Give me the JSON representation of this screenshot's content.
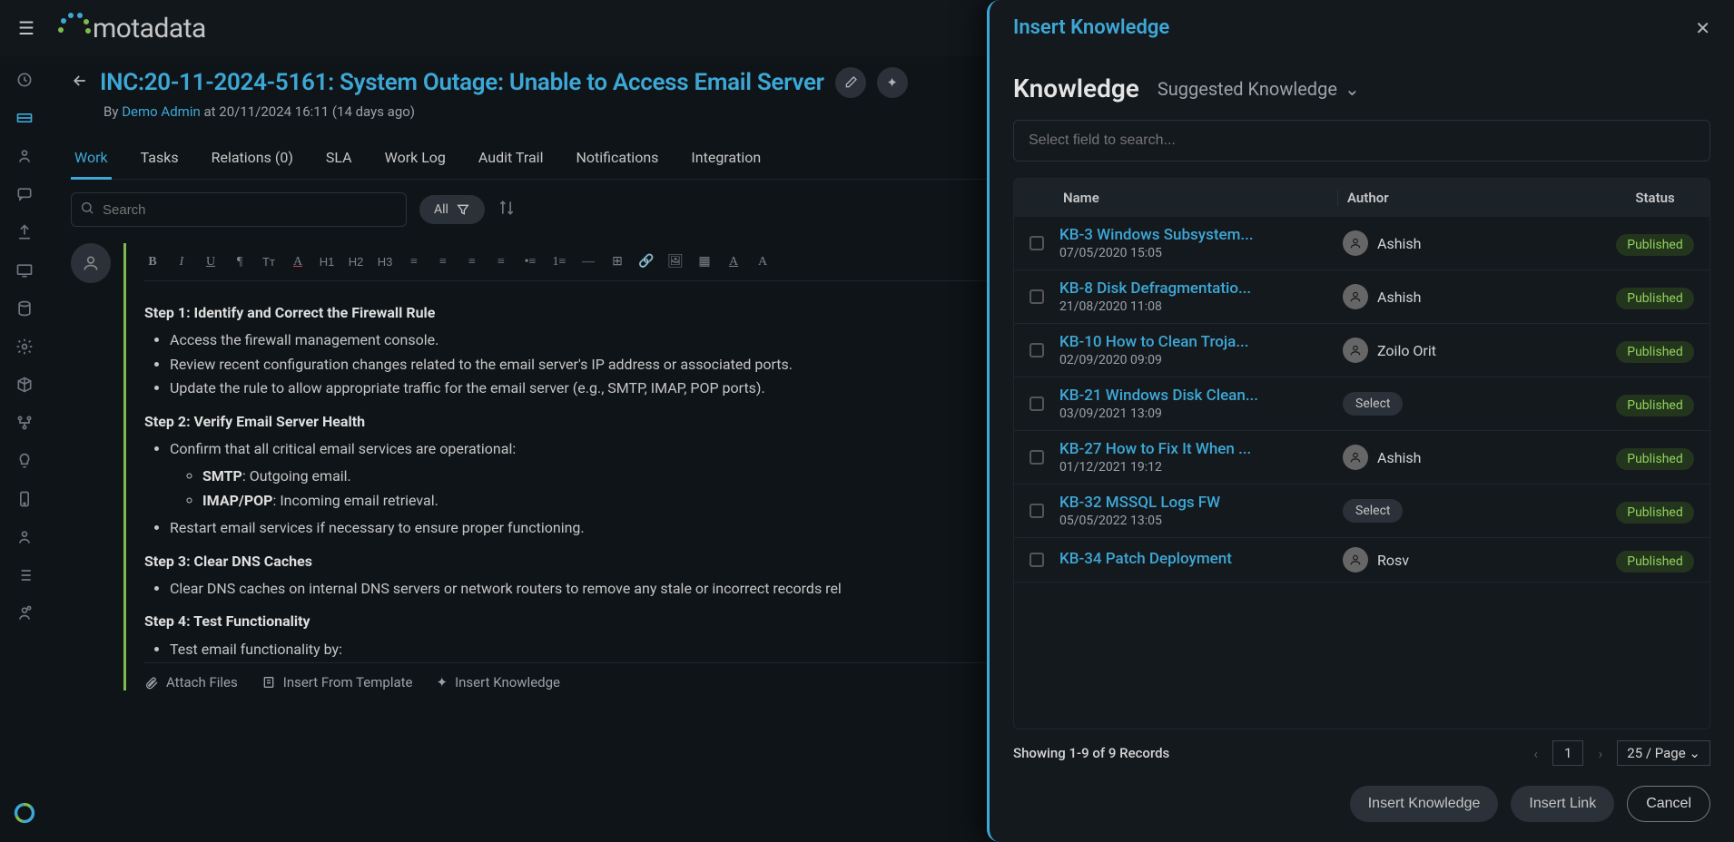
{
  "app": {
    "name": "motadata"
  },
  "ticket": {
    "id_title": "INC:20-11-2024-5161: System Outage: Unable to Access Email Server",
    "by_label": "By",
    "author": "Demo Admin",
    "at_text": "at 20/11/2024 16:11 (14 days ago)"
  },
  "tabs": {
    "work": "Work",
    "tasks": "Tasks",
    "relations": "Relations (0)",
    "sla": "SLA",
    "worklog": "Work Log",
    "audit": "Audit Trail",
    "notifications": "Notifications",
    "integration": "Integration"
  },
  "tool": {
    "search_ph": "Search",
    "all": "All"
  },
  "editor": {
    "step1_h": "Step 1: Identify and Correct the Firewall Rule",
    "step1_b1": "Access the firewall management console.",
    "step1_b2": "Review recent configuration changes related to the email server's IP address or associated ports.",
    "step1_b3": "Update the rule to allow appropriate traffic for the email server (e.g., SMTP, IMAP, POP ports).",
    "step2_h": "Step 2: Verify Email Server Health",
    "step2_b1": "Confirm that all critical email services are operational:",
    "step2_s1a": "SMTP",
    "step2_s1b": ": Outgoing email.",
    "step2_s2a": "IMAP/POP",
    "step2_s2b": ": Incoming email retrieval.",
    "step2_b2": "Restart email services if necessary to ensure proper functioning.",
    "step3_h": "Step 3: Clear DNS Caches",
    "step3_b1": "Clear DNS caches on internal DNS servers or network routers to remove any stale or incorrect records rel",
    "step4_h": "Step 4: Test Functionality",
    "step4_b1": "Test email functionality by:",
    "foot_attach": "Attach Files",
    "foot_template": "Insert From Template",
    "foot_knowledge": "Insert Knowledge"
  },
  "panel": {
    "title": "Insert Knowledge",
    "tab1": "Knowledge",
    "tab2": "Suggested Knowledge",
    "search_ph": "Select field to search...",
    "col_name": "Name",
    "col_author": "Author",
    "col_status": "Status",
    "select_txt": "Select",
    "records": "Showing 1-9 of 9 Records",
    "page_num": "1",
    "page_size": "25 / Page",
    "btn_insert_k": "Insert Knowledge",
    "btn_insert_l": "Insert Link",
    "btn_cancel": "Cancel",
    "rows": [
      {
        "name": "KB-3 Windows Subsystem...",
        "date": "07/05/2020 15:05",
        "author": "Ashish",
        "avatar": true,
        "status": "Published"
      },
      {
        "name": "KB-8 Disk Defragmentatio...",
        "date": "21/08/2020 11:08",
        "author": "Ashish",
        "avatar": true,
        "status": "Published"
      },
      {
        "name": "KB-10 How to Clean Troja...",
        "date": "02/09/2020 09:09",
        "author": "Zoilo Orit",
        "avatar": true,
        "status": "Published"
      },
      {
        "name": "KB-21 Windows Disk Clean...",
        "date": "03/09/2021 13:09",
        "author": "Select",
        "avatar": false,
        "status": "Published"
      },
      {
        "name": "KB-27 How to Fix It When ...",
        "date": "01/12/2021 19:12",
        "author": "Ashish",
        "avatar": true,
        "status": "Published"
      },
      {
        "name": "KB-32 MSSQL Logs FW",
        "date": "05/05/2022 13:05",
        "author": "Select",
        "avatar": false,
        "status": "Published"
      },
      {
        "name": "KB-34 Patch Deployment",
        "date": "",
        "author": "Rosv",
        "avatar": true,
        "status": "Published"
      }
    ]
  }
}
